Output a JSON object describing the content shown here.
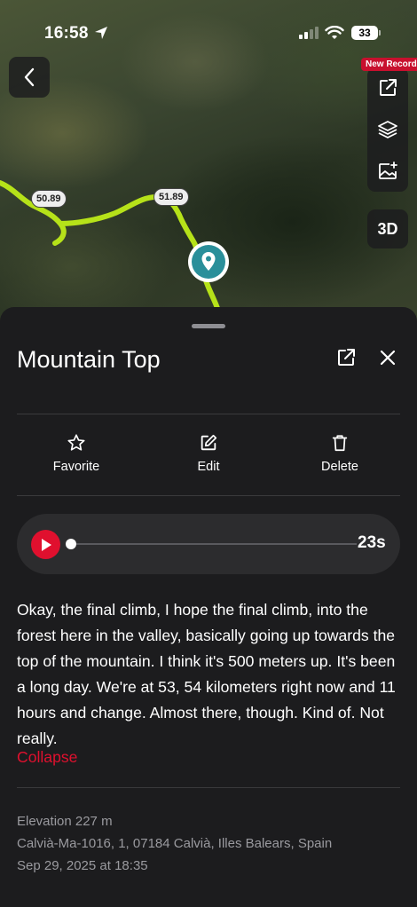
{
  "status_bar": {
    "time": "16:58",
    "battery": "33"
  },
  "map": {
    "badge": "New Record",
    "btn_3d": "3D",
    "km_markers": [
      "50.89",
      "51.89"
    ],
    "route_color": "#b6e219",
    "pin_color": "#2a8f9a"
  },
  "sheet": {
    "title": "Mountain Top",
    "actions": [
      {
        "label": "Favorite",
        "icon": "star-icon"
      },
      {
        "label": "Edit",
        "icon": "edit-icon"
      },
      {
        "label": "Delete",
        "icon": "trash-icon"
      }
    ],
    "player": {
      "duration": "23s",
      "progress": 0,
      "accent": "#e0102e"
    },
    "transcript": "Okay, the final climb, I hope the final climb, into the forest here in the valley, basically going up towards the top of the mountain. I think it's 500 meters up. It's been a long day. We're at 53, 54 kilometers right now and 11 hours and change. Almost there, though. Kind of. Not really.",
    "collapse_label": "Collapse",
    "meta": {
      "elevation": "Elevation 227 m",
      "address": "Calvià-Ma-1016, 1, 07184 Calvià, Illes Balears, Spain",
      "date": "Sep 29, 2025 at 18:35"
    }
  }
}
